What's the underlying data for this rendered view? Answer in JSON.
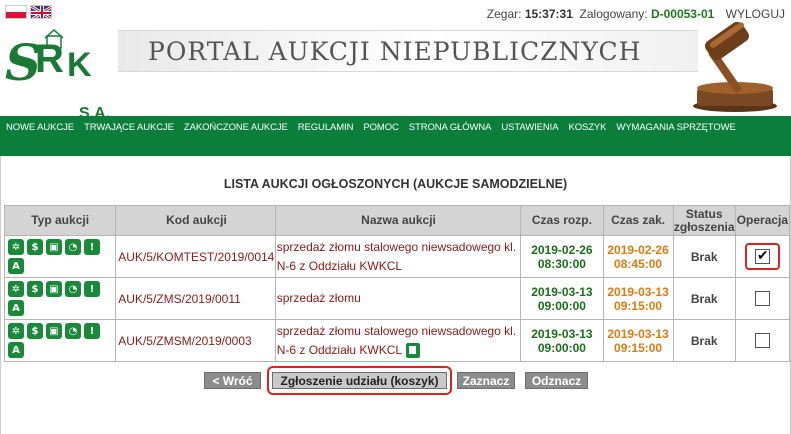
{
  "header": {
    "clock_label": "Zegar:",
    "clock_value": "15:37:31",
    "logged_label": "Zalogowany:",
    "user_id": "D-00053-01",
    "logout": "WYLOGUJ",
    "logo_text": "SRK",
    "logo_suffix": "S.A.",
    "portal_title": "PORTAL AUKCJI NIEPUBLICZNYCH"
  },
  "nav": [
    "NOWE AUKCJE",
    "TRWAJĄCE AUKCJE",
    "ZAKOŃCZONE AUKCJE",
    "REGULAMIN",
    "POMOC",
    "STRONA GŁÓWNA",
    "USTAWIENIA",
    "KOSZYK",
    "WYMAGANIA SPRZĘTOWE"
  ],
  "list_title": "LISTA AUKCJI OGŁOSZONYCH (AUKCJE SAMODZIELNE)",
  "table": {
    "headers": {
      "type": "Typ aukcji",
      "code": "Kod aukcji",
      "name": "Nazwa aukcji",
      "start": "Czas rozp.",
      "end": "Czas zak.",
      "status": "Status zgłoszenia",
      "op": "Operacja"
    },
    "rows": [
      {
        "code": "AUK/5/KOMTEST/2019/0014",
        "name": "sprzedaż złomu stalowego niewsadowego kl. N-6 z Oddziału KWKCL",
        "start_date": "2019-02-26",
        "start_time": "08:30:00",
        "end_date": "2019-02-26",
        "end_time": "08:45:00",
        "status": "Brak",
        "checked": true
      },
      {
        "code": "AUK/5/ZMS/2019/0011",
        "name": "sprzedaż złomu",
        "start_date": "2019-03-13",
        "start_time": "09:00:00",
        "end_date": "2019-03-13",
        "end_time": "09:15:00",
        "status": "Brak",
        "checked": false
      },
      {
        "code": "AUK/5/ZMSM/2019/0003",
        "name": "sprzedaż złomu stalowego niewsadowego kl. N-6 z Oddziału KWKCL",
        "start_date": "2019-03-13",
        "start_time": "09:00:00",
        "end_date": "2019-03-13",
        "end_time": "09:15:00",
        "status": "Brak",
        "checked": false
      }
    ]
  },
  "buttons": {
    "back": "< Wróć",
    "submit": "Zgłoszenie udziału (koszyk)",
    "select": "Zaznacz",
    "deselect": "Odznacz"
  },
  "colors": {
    "nav_bg": "#0b7e3b",
    "start_time": "#1a6f1a",
    "end_time": "#e07a10",
    "code_text": "#8b1a1a",
    "highlight": "#dd2222"
  }
}
